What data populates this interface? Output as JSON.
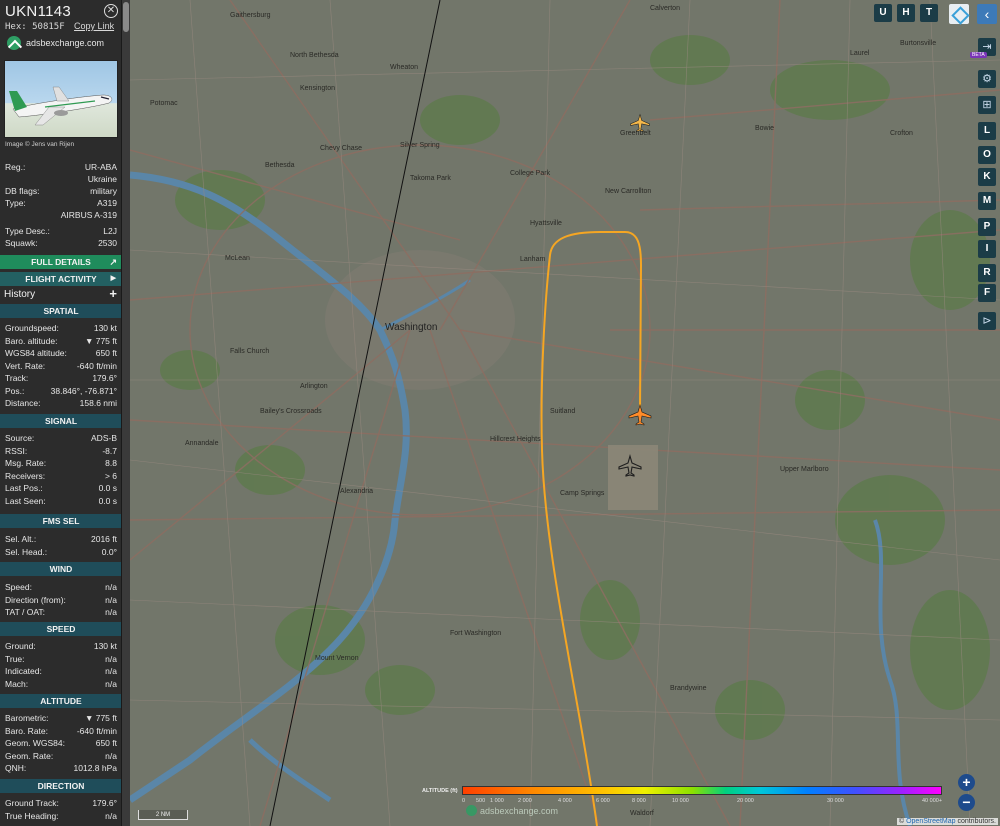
{
  "sidebar": {
    "callsign": "UKN1143",
    "hex_label": "Hex:",
    "hex": "50815F",
    "copy_link": "Copy Link",
    "close_icon": "close-icon",
    "adsb_link": "adsbexchange.com",
    "photo_credit": "Image © Jens van Rijen",
    "info": [
      {
        "k": "Reg.:",
        "v": "UR-ABA"
      },
      {
        "k": "",
        "v": "Ukraine"
      },
      {
        "k": "DB flags:",
        "v": "military"
      },
      {
        "k": "Type:",
        "v": "A319"
      },
      {
        "k": "",
        "v": "AIRBUS A-319"
      },
      {
        "k": "Type Desc.:",
        "v": "L2J"
      },
      {
        "k": "Squawk:",
        "v": "2530"
      }
    ],
    "full_details": "FULL DETAILS",
    "flight_activity": "FLIGHT ACTIVITY",
    "history": "History",
    "sections": {
      "spatial": {
        "title": "SPATIAL",
        "rows": [
          {
            "k": "Groundspeed:",
            "v": "130 kt"
          },
          {
            "k": "Baro. altitude:",
            "v": "▼ 775 ft"
          },
          {
            "k": "WGS84 altitude:",
            "v": "650 ft"
          },
          {
            "k": "Vert. Rate:",
            "v": "-640 ft/min"
          },
          {
            "k": "Track:",
            "v": "179.6°"
          },
          {
            "k": "Pos.:",
            "v": "38.846°, -76.871°"
          },
          {
            "k": "Distance:",
            "v": "158.6 nmi"
          }
        ]
      },
      "signal": {
        "title": "SIGNAL",
        "rows": [
          {
            "k": "Source:",
            "v": "ADS-B"
          },
          {
            "k": "RSSI:",
            "v": "-8.7"
          },
          {
            "k": "Msg. Rate:",
            "v": "8.8"
          },
          {
            "k": "Receivers:",
            "v": "> 6"
          },
          {
            "k": "Last Pos.:",
            "v": "0.0 s"
          },
          {
            "k": "Last Seen:",
            "v": "0.0 s"
          }
        ]
      },
      "fms": {
        "title": "FMS SEL",
        "rows": [
          {
            "k": "Sel. Alt.:",
            "v": "2016 ft"
          },
          {
            "k": "Sel. Head.:",
            "v": "0.0°"
          }
        ]
      },
      "wind": {
        "title": "WIND",
        "rows": [
          {
            "k": "Speed:",
            "v": "n/a"
          },
          {
            "k": "Direction (from):",
            "v": "n/a"
          },
          {
            "k": "TAT / OAT:",
            "v": "n/a"
          }
        ]
      },
      "speed": {
        "title": "SPEED",
        "rows": [
          {
            "k": "Ground:",
            "v": "130 kt"
          },
          {
            "k": "True:",
            "v": "n/a"
          },
          {
            "k": "Indicated:",
            "v": "n/a"
          },
          {
            "k": "Mach:",
            "v": "n/a"
          }
        ]
      },
      "altitude": {
        "title": "ALTITUDE",
        "rows": [
          {
            "k": "Barometric:",
            "v": "▼ 775 ft"
          },
          {
            "k": "Baro. Rate:",
            "v": "-640 ft/min"
          },
          {
            "k": "Geom. WGS84:",
            "v": "650 ft"
          },
          {
            "k": "Geom. Rate:",
            "v": "n/a"
          },
          {
            "k": "QNH:",
            "v": "1012.8 hPa"
          }
        ]
      },
      "direction": {
        "title": "DIRECTION",
        "rows": [
          {
            "k": "Ground Track:",
            "v": "179.6°"
          },
          {
            "k": "True Heading:",
            "v": "n/a"
          }
        ]
      }
    }
  },
  "toolbar": {
    "top_buttons": [
      "U",
      "H",
      "T"
    ],
    "right_letters": [
      "L",
      "O",
      "K",
      "M",
      "P",
      "I",
      "R",
      "F"
    ],
    "beta": "BETA",
    "icons": [
      "layers-icon",
      "collapse-icon",
      "login-icon",
      "settings-icon",
      "sitemap-icon",
      "replay-icon"
    ]
  },
  "map": {
    "labels": [
      {
        "t": "Gaithersburg",
        "cls": ""
      },
      {
        "t": "North Bethesda",
        "cls": ""
      },
      {
        "t": "Kensington",
        "cls": ""
      },
      {
        "t": "Wheaton",
        "cls": ""
      },
      {
        "t": "Silver Spring",
        "cls": ""
      },
      {
        "t": "Takoma Park",
        "cls": ""
      },
      {
        "t": "Bethesda",
        "cls": ""
      },
      {
        "t": "Chevy Chase",
        "cls": ""
      },
      {
        "t": "Hyattsville",
        "cls": ""
      },
      {
        "t": "College Park",
        "cls": ""
      },
      {
        "t": "Greenbelt",
        "cls": ""
      },
      {
        "t": "New Carrollton",
        "cls": ""
      },
      {
        "t": "Lanham",
        "cls": ""
      },
      {
        "t": "Washington",
        "cls": "big"
      },
      {
        "t": "Arlington",
        "cls": ""
      },
      {
        "t": "McLean",
        "cls": ""
      },
      {
        "t": "Falls Church",
        "cls": ""
      },
      {
        "t": "Annandale",
        "cls": ""
      },
      {
        "t": "Bailey's Crossroads",
        "cls": ""
      },
      {
        "t": "Alexandria",
        "cls": ""
      },
      {
        "t": "Suitland",
        "cls": ""
      },
      {
        "t": "Hillcrest Heights",
        "cls": ""
      },
      {
        "t": "Camp Springs",
        "cls": ""
      },
      {
        "t": "Upper Marlboro",
        "cls": ""
      },
      {
        "t": "Fort Washington",
        "cls": ""
      },
      {
        "t": "Mount Vernon",
        "cls": ""
      },
      {
        "t": "Brandywine",
        "cls": ""
      },
      {
        "t": "Waldorf",
        "cls": ""
      },
      {
        "t": "Calverton",
        "cls": ""
      },
      {
        "t": "Bowie",
        "cls": ""
      },
      {
        "t": "Crofton",
        "cls": ""
      },
      {
        "t": "Burtonsville",
        "cls": ""
      },
      {
        "t": "Laurel",
        "cls": ""
      },
      {
        "t": "Potomac",
        "cls": ""
      }
    ],
    "scale": "2 NM",
    "altitude_legend": {
      "title": "ALTITUDE (ft)",
      "ticks": [
        "0",
        "500",
        "1 000",
        "2 000",
        "4 000",
        "6 000",
        "8 000",
        "10 000",
        "20 000",
        "30 000",
        "40 000+"
      ]
    },
    "watermark": "adsbexchange.com",
    "attribution_prefix": "©",
    "attribution_link": "OpenStreetMap",
    "attribution_suffix": "contributors."
  },
  "colors": {
    "track": "#f5a623",
    "aircraft_selected": "#ff8c2a",
    "aircraft_other": "#1e1e1e",
    "sidebar_bg": "#2c2c2c",
    "section_header": "#1f4d5a",
    "full_details": "#1f8c5c"
  }
}
